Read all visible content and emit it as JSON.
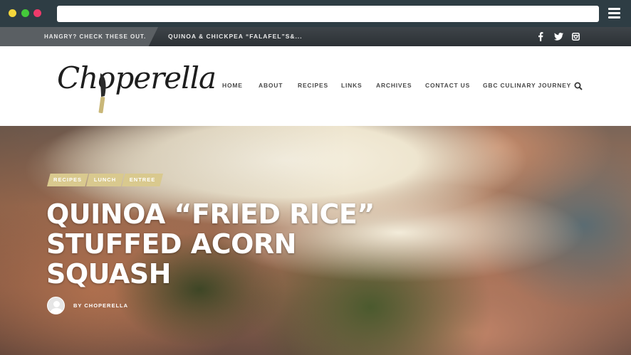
{
  "topbar": {
    "label": "HANGRY? CHECK THESE OUT.",
    "ticker": "QUINOA & CHICKPEA “FALAFEL”S&...",
    "social": [
      {
        "name": "facebook-icon"
      },
      {
        "name": "twitter-icon"
      },
      {
        "name": "instagram-icon"
      }
    ]
  },
  "header": {
    "logo_text": "Choperella",
    "nav": [
      "HOME",
      "ABOUT",
      "RECIPES",
      "LINKS",
      "ARCHIVES",
      "CONTACT US",
      "GBC CULINARY JOURNEY"
    ]
  },
  "hero": {
    "categories": [
      "RECIPES",
      "LUNCH",
      "ENTREE"
    ],
    "title_lines": [
      "QUINOA “FRIED RICE”",
      "STUFFED ACORN",
      "SQUASH"
    ],
    "byline": "BY CHOPERELLA"
  },
  "colors": {
    "accent": "#d9c98e",
    "chrome": "#2e3d44",
    "topbar": "#34393d"
  }
}
